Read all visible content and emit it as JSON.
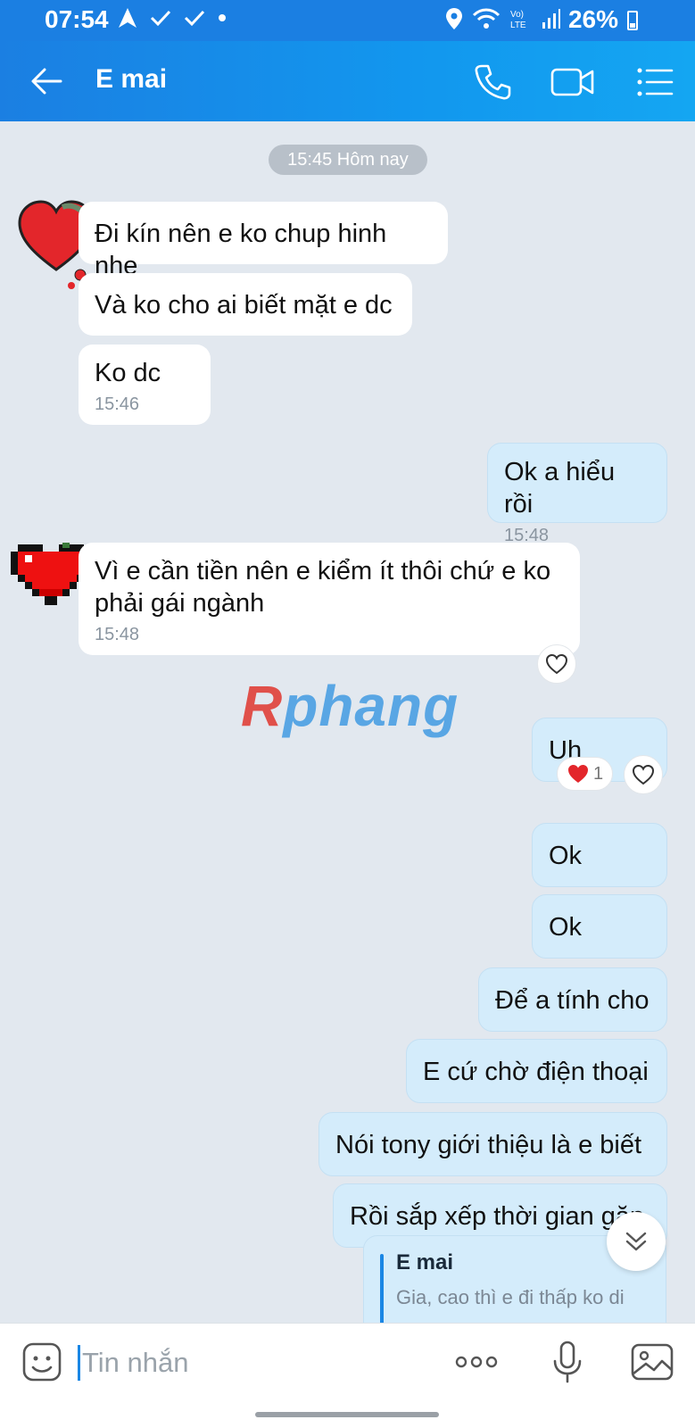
{
  "status_bar": {
    "time": "07:54",
    "battery": "26%"
  },
  "header": {
    "title": "E mai"
  },
  "chat": {
    "date_separator": "15:45 Hôm nay",
    "messages": [
      {
        "direction": "in",
        "text": "Đi kín nên e ko chup hinh nhe",
        "time": ""
      },
      {
        "direction": "in",
        "text": "Và ko cho ai biết mặt e dc",
        "time": ""
      },
      {
        "direction": "in",
        "text": "Ko dc",
        "time": "15:46"
      },
      {
        "direction": "out",
        "text": "Ok a hiểu rồi",
        "time": "15:48"
      },
      {
        "direction": "in",
        "text": "Vì e cần tiền nên e kiểm ít thôi chứ e ko phải gái ngành",
        "time": "15:48"
      },
      {
        "direction": "out",
        "text": "Uh",
        "time": "",
        "reaction_count": "1"
      },
      {
        "direction": "out",
        "text": "Ok",
        "time": ""
      },
      {
        "direction": "out",
        "text": "Ok",
        "time": ""
      },
      {
        "direction": "out",
        "text": "Để a tính cho",
        "time": ""
      },
      {
        "direction": "out",
        "text": "E cứ chờ điện thoại",
        "time": ""
      },
      {
        "direction": "out",
        "text": "Nói tony giới thiệu là e biết",
        "time": ""
      },
      {
        "direction": "out",
        "text": "Rồi sắp xếp thời gian gặp",
        "time": ""
      }
    ],
    "quote": {
      "name": "E mai",
      "text": "Gia, cao thì e đi thấp ko di"
    },
    "watermark": {
      "first": "R",
      "rest": "phang"
    }
  },
  "composer": {
    "placeholder": "Tin nhắn"
  },
  "colors": {
    "header_start": "#1b7fe2",
    "header_end": "#14a6f2",
    "chat_bg": "#e2e8ef",
    "outgoing_bubble": "#d4ecfb",
    "incoming_bubble": "#ffffff",
    "accent": "#1a86e4"
  },
  "icons": [
    "navigation-icon",
    "check-icon",
    "location-icon",
    "wifi-icon",
    "signal-icon",
    "back-arrow-icon",
    "phone-icon",
    "video-call-icon",
    "menu-list-icon",
    "heart-icon",
    "sticker-icon",
    "more-icon",
    "microphone-icon",
    "image-icon",
    "chevron-down-icon"
  ]
}
